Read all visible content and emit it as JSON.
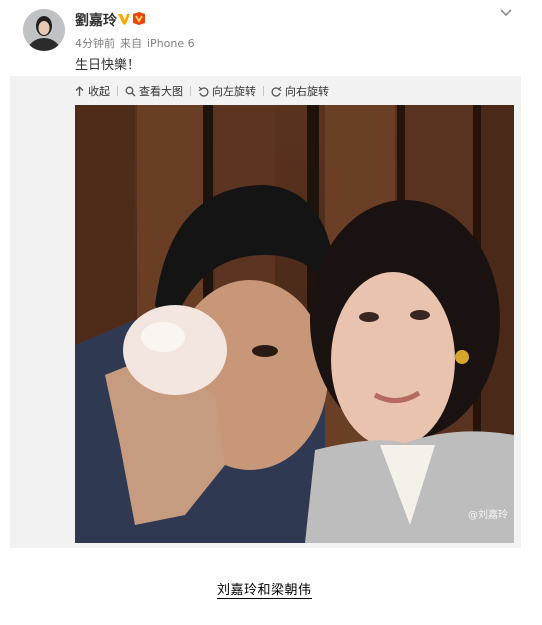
{
  "post": {
    "username": "劉嘉玲",
    "time": "4分钟前",
    "source_prefix": "来自",
    "source_device": "iPhone 6",
    "text": "生日快樂！"
  },
  "toolbar": {
    "collapse_label": "收起",
    "view_large_label": "查看大图",
    "rotate_left_label": "向左旋转",
    "rotate_right_label": "向右旋转"
  },
  "photo": {
    "watermark": "@刘嘉玲"
  },
  "caption": "刘嘉玲和梁朝伟",
  "colors": {
    "verified_badge": "#f7ab00",
    "vip_badge": "#e8470b",
    "link": "#333333",
    "meta": "#808080",
    "media_bg": "#f2f2f2"
  },
  "icons": [
    "chevron-down-icon",
    "verified-icon",
    "vip-icon",
    "collapse-icon",
    "magnifier-icon",
    "rotate-left-icon",
    "rotate-right-icon"
  ]
}
